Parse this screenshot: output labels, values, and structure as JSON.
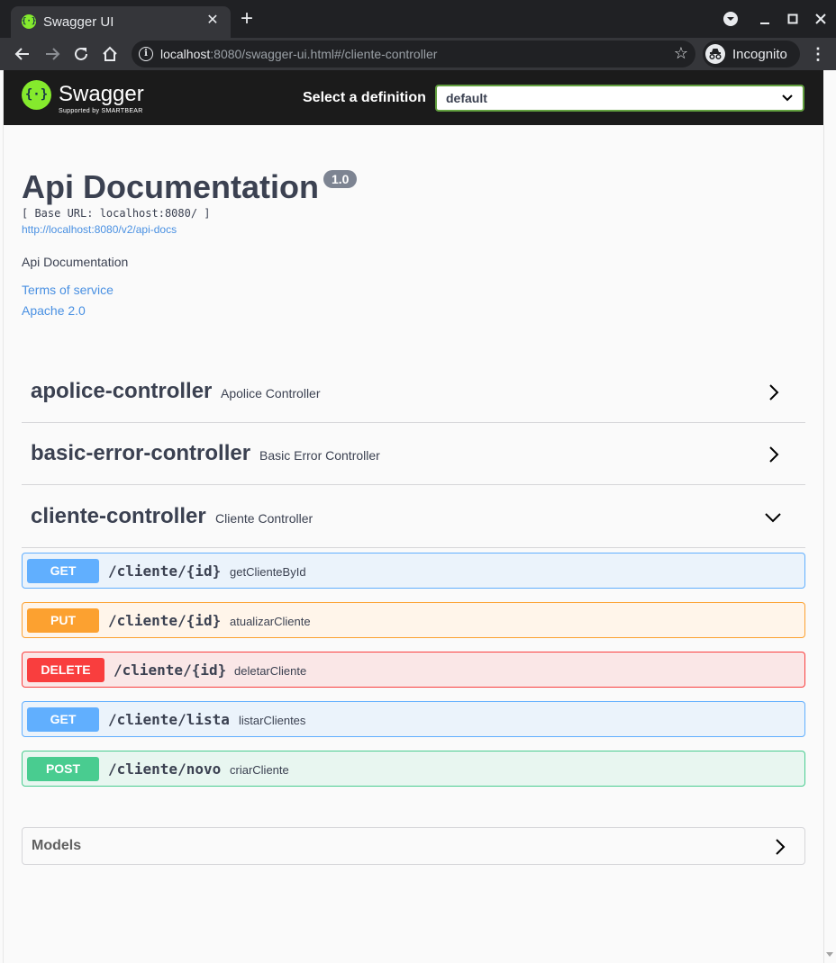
{
  "browser": {
    "tab_title": "Swagger UI",
    "url_host": "localhost",
    "url_rest": ":8080/swagger-ui.html#/cliente-controller",
    "profile_label": "Incognito"
  },
  "topbar": {
    "logo_text": "Swagger",
    "logo_sub": "Supported by SMARTBEAR",
    "definition_label": "Select a definition",
    "definition_value": "default"
  },
  "info": {
    "title": "Api Documentation",
    "version": "1.0",
    "base_url": "[ Base URL: localhost:8080/ ]",
    "docs_link": "http://localhost:8080/v2/api-docs",
    "description": "Api Documentation",
    "terms_link": "Terms of service",
    "license_link": "Apache 2.0"
  },
  "tags": [
    {
      "name": "apolice-controller",
      "description": "Apolice Controller",
      "expanded": false
    },
    {
      "name": "basic-error-controller",
      "description": "Basic Error Controller",
      "expanded": false
    },
    {
      "name": "cliente-controller",
      "description": "Cliente Controller",
      "expanded": true
    }
  ],
  "operations": [
    {
      "method": "GET",
      "path": "/cliente/{id}",
      "summary": "getClienteById"
    },
    {
      "method": "PUT",
      "path": "/cliente/{id}",
      "summary": "atualizarCliente"
    },
    {
      "method": "DELETE",
      "path": "/cliente/{id}",
      "summary": "deletarCliente"
    },
    {
      "method": "GET",
      "path": "/cliente/lista",
      "summary": "listarClientes"
    },
    {
      "method": "POST",
      "path": "/cliente/novo",
      "summary": "criarCliente"
    }
  ],
  "models": {
    "title": "Models"
  },
  "colors": {
    "get": "#61affe",
    "put": "#fca130",
    "delete": "#f93e3e",
    "post": "#49cc90",
    "swagger_green": "#85ea2d",
    "link": "#4990e2"
  }
}
